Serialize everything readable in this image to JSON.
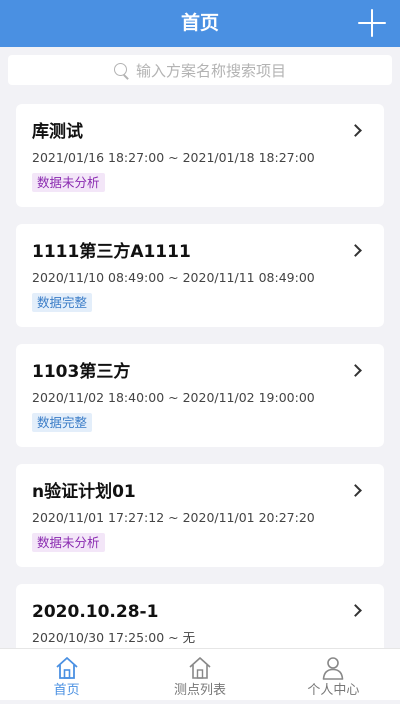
{
  "nav": {
    "title": "首页",
    "add_icon": "plus-icon"
  },
  "search": {
    "placeholder": "输入方案名称搜索项目",
    "icon": "search-icon"
  },
  "projects": [
    {
      "title": "库测试",
      "time": "2021/01/16 18:27:00 ~ 2021/01/18 18:27:00",
      "status": "数据未分析",
      "status_color": "#8a2bb0"
    },
    {
      "title": "1111第三方A1111",
      "time": "2020/11/10 08:49:00 ~ 2020/11/11 08:49:00",
      "status": "数据完整",
      "status_color": "#3a7cc7"
    },
    {
      "title": "1103第三方",
      "time": "2020/11/02 18:40:00 ~ 2020/11/02 19:00:00",
      "status": "数据完整",
      "status_color": "#3a7cc7"
    },
    {
      "title": "n验证计划01",
      "time": "2020/11/01 17:27:12 ~ 2020/11/01 20:27:20",
      "status": "数据未分析",
      "status_color": "#8a2bb0"
    },
    {
      "title": "2020.10.28-1",
      "time": "2020/10/30 17:25:00 ~ 无",
      "status": "",
      "status_color": ""
    }
  ],
  "tabbar": {
    "items": [
      {
        "label": "首页",
        "icon": "home-icon",
        "active": true
      },
      {
        "label": "测点列表",
        "icon": "home-outline-icon",
        "active": false
      },
      {
        "label": "个人中心",
        "icon": "user-icon",
        "active": false
      }
    ]
  },
  "colors": {
    "primary": "#4a90e2",
    "background": "#f2f2f6"
  }
}
